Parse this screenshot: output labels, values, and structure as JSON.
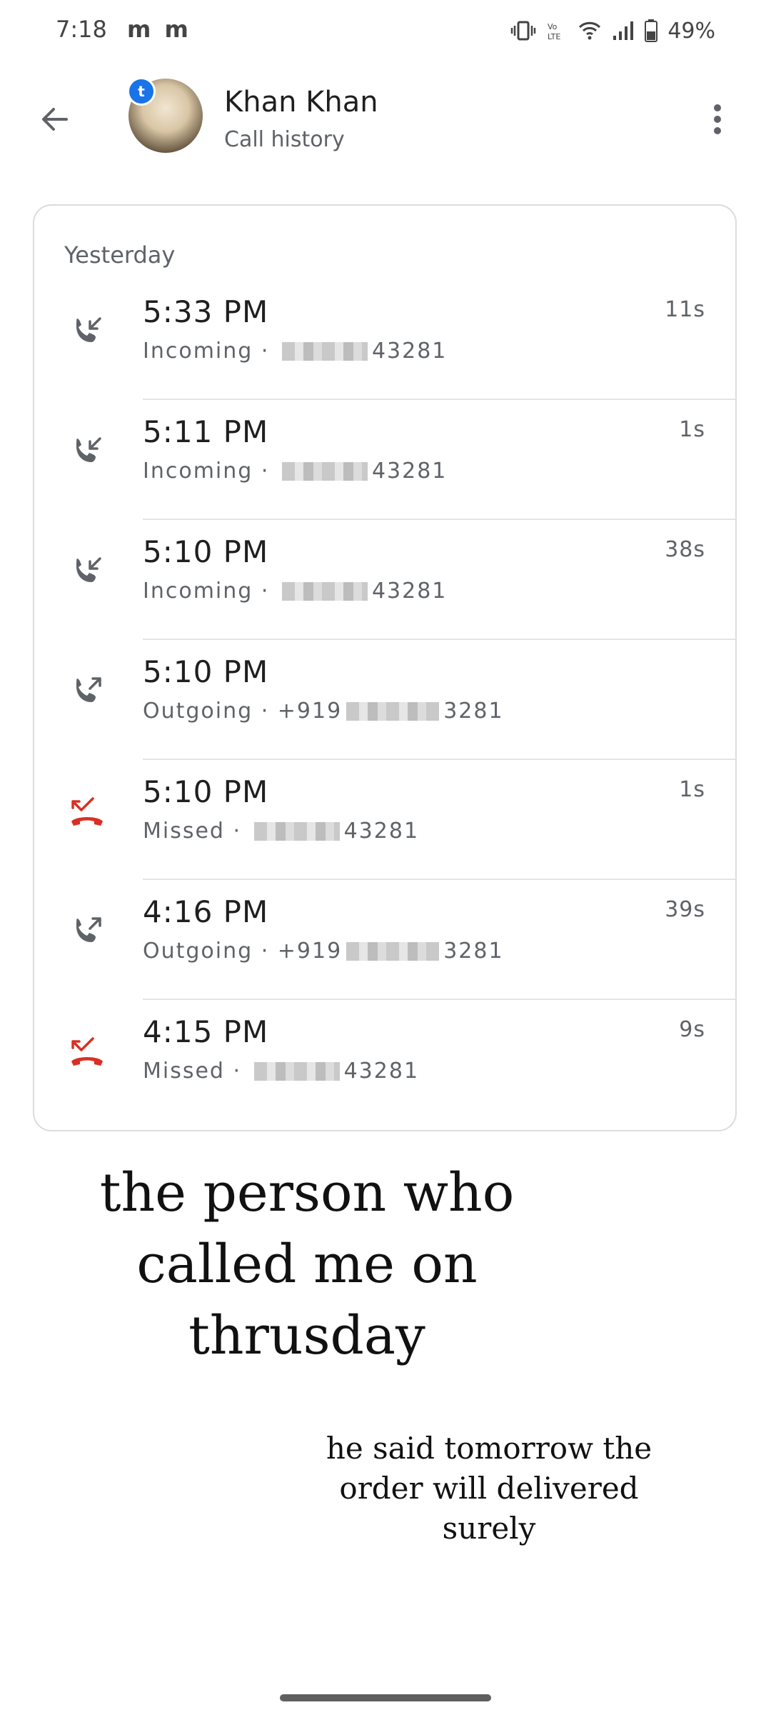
{
  "status_bar": {
    "time": "7:18",
    "notification_icons": "m m",
    "battery_percent": "49%"
  },
  "header": {
    "contact_name": "Khan Khan",
    "subtitle": "Call history",
    "badge_letter": "t"
  },
  "card": {
    "section_label": "Yesterday",
    "calls": [
      {
        "time": "5:33 PM",
        "type": "Incoming",
        "number_prefix": "",
        "number_suffix": "43281",
        "duration": "11s",
        "icon": "incoming-call-icon"
      },
      {
        "time": "5:11 PM",
        "type": "Incoming",
        "number_prefix": "",
        "number_suffix": "43281",
        "duration": "1s",
        "icon": "incoming-call-icon"
      },
      {
        "time": "5:10 PM",
        "type": "Incoming",
        "number_prefix": "",
        "number_suffix": "43281",
        "duration": "38s",
        "icon": "incoming-call-icon"
      },
      {
        "time": "5:10 PM",
        "type": "Outgoing",
        "number_prefix": "+919",
        "number_suffix": "3281",
        "duration": "",
        "icon": "outgoing-call-icon"
      },
      {
        "time": "5:10 PM",
        "type": "Missed",
        "number_prefix": "",
        "number_suffix": "43281",
        "duration": "1s",
        "icon": "missed-call-icon"
      },
      {
        "time": "4:16 PM",
        "type": "Outgoing",
        "number_prefix": "+919",
        "number_suffix": "3281",
        "duration": "39s",
        "icon": "outgoing-call-icon"
      },
      {
        "time": "4:15 PM",
        "type": "Missed",
        "number_prefix": "",
        "number_suffix": "43281",
        "duration": "9s",
        "icon": "missed-call-icon"
      }
    ]
  },
  "notes": {
    "big_line1": "the person who",
    "big_line2": "called me on",
    "big_line3": "thrusday",
    "small_line1": "he said tomorrow the",
    "small_line2": "order will delivered",
    "small_line3": "surely"
  },
  "colors": {
    "missed": "#d93025",
    "icon_gray": "#5f6368",
    "accent": "#1a73e8"
  }
}
